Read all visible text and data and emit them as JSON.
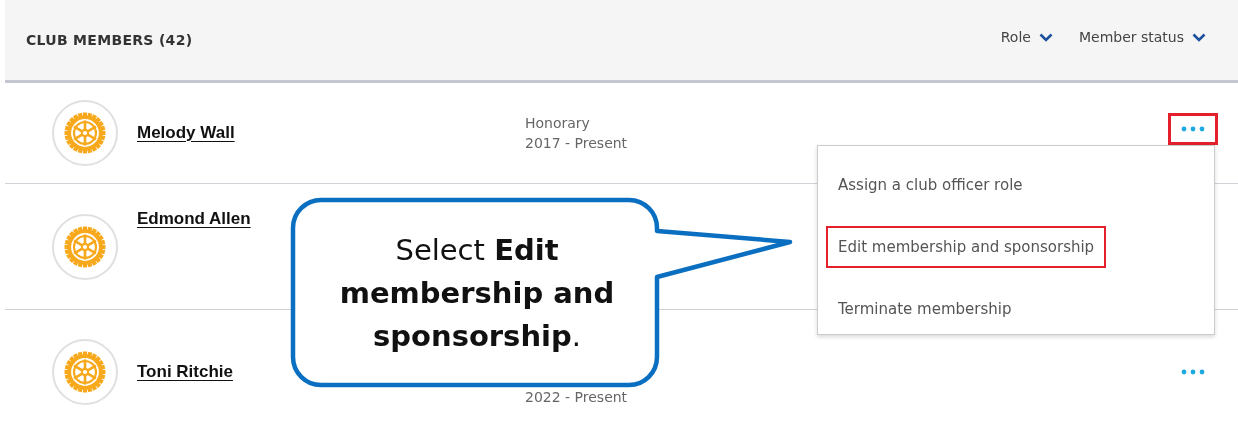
{
  "header": {
    "title": "CLUB MEMBERS (42)",
    "filters": [
      {
        "label": "Role"
      },
      {
        "label": "Member status"
      }
    ]
  },
  "members": [
    {
      "name": "Melody Wall",
      "role": "Honorary",
      "years": "2017 - Present",
      "menu_open": true,
      "more_highlighted": true
    },
    {
      "name": "Edmond Allen",
      "menu_open": false
    },
    {
      "name": "Toni Ritchie",
      "years": "2022 - Present",
      "menu_open": false,
      "more_highlighted": false
    }
  ],
  "menu": {
    "items": [
      {
        "label": "Assign a club officer role",
        "highlighted": false
      },
      {
        "label": "Edit membership and sponsorship",
        "highlighted": true
      },
      {
        "label": "Terminate membership",
        "highlighted": false
      }
    ]
  },
  "callout": {
    "text": "Select **Edit membership and sponsorship**."
  }
}
